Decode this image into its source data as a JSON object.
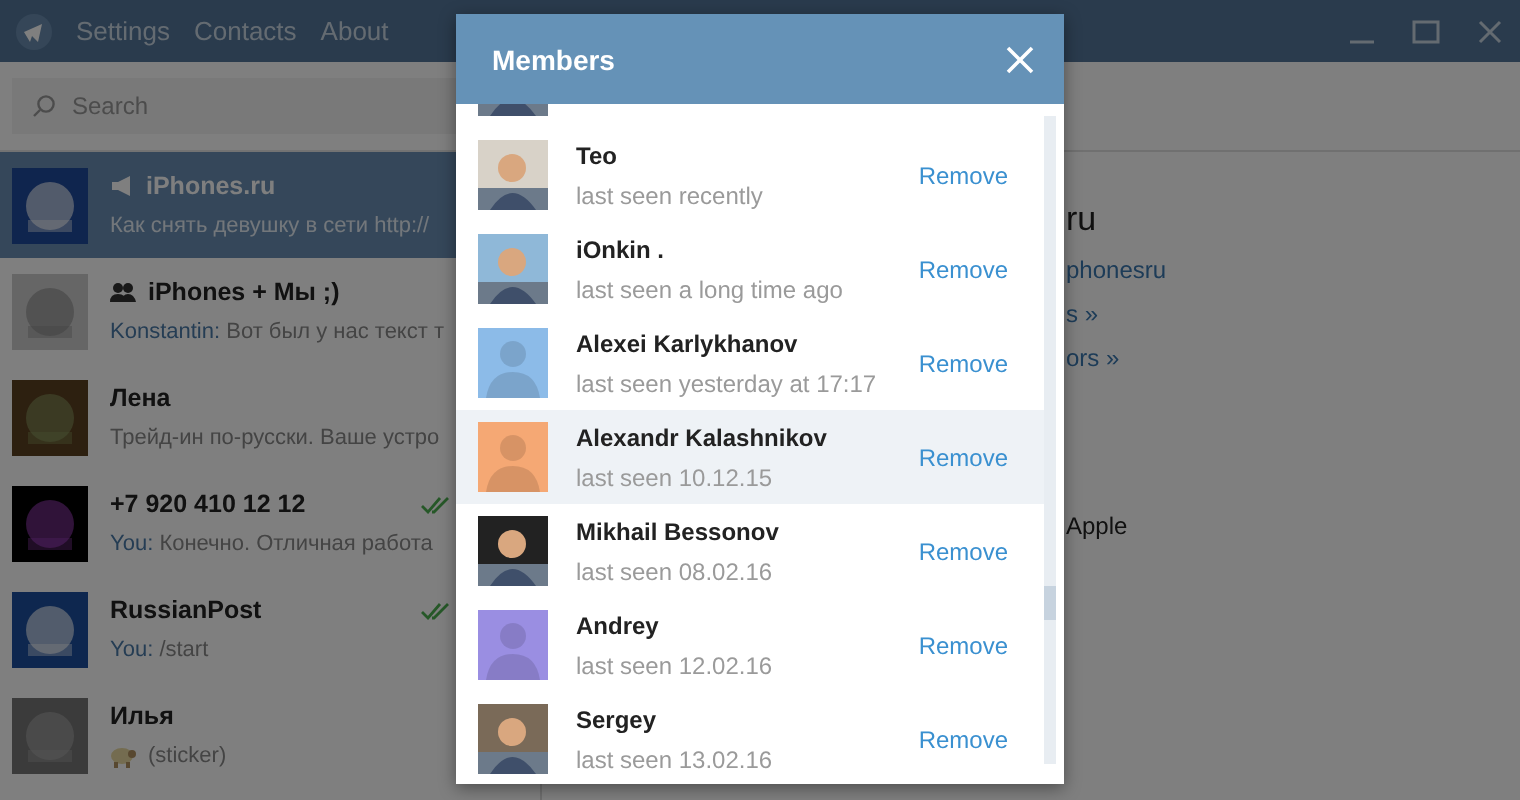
{
  "menu": [
    "Settings",
    "Contacts",
    "About"
  ],
  "search": {
    "placeholder": "Search"
  },
  "chats": [
    {
      "kind": "channel",
      "name": "iPhones.ru",
      "preview": "Как снять девушку в сети http://",
      "read": false,
      "selected": true
    },
    {
      "kind": "group",
      "name": "iPhones + Мы ;)",
      "preview_sender": "Konstantin:",
      "preview": "Вот был у нас текст т",
      "read": false,
      "selected": false
    },
    {
      "kind": "user",
      "name": "Лена",
      "preview": "Трейд-ин по-русски. Ваше устро",
      "read": false,
      "selected": false
    },
    {
      "kind": "user",
      "name": "+7 920 410 12 12",
      "preview_sender": "You:",
      "preview": "Конечно. Отличная работа",
      "read": true,
      "selected": false
    },
    {
      "kind": "user",
      "name": "RussianPost",
      "preview_sender": "You:",
      "preview": "/start",
      "read": true,
      "selected": false
    },
    {
      "kind": "user",
      "name": "Илья",
      "preview": "(sticker)",
      "sticker": true,
      "read": false,
      "selected": false
    }
  ],
  "profile": {
    "title": "ru",
    "link": "phonesru",
    "links": [
      "s »",
      "ors »"
    ],
    "about": "Apple"
  },
  "dialog": {
    "title": "Members",
    "members": [
      {
        "name": "Teo",
        "status": "last seen recently",
        "action": "Remove",
        "hovered": false
      },
      {
        "name": "iOnkin .",
        "status": "last seen a long time ago",
        "action": "Remove",
        "hovered": false
      },
      {
        "kind": "silhouette",
        "color": "#8cbbe8",
        "name": "Alexei Karlykhanov",
        "status": "last seen yesterday at 17:17",
        "action": "Remove",
        "hovered": false
      },
      {
        "kind": "silhouette",
        "color": "#f5a874",
        "name": "Alexandr Kalashnikov",
        "status": "last seen 10.12.15",
        "action": "Remove",
        "hovered": true
      },
      {
        "name": "Mikhail Bessonov",
        "status": "last seen 08.02.16",
        "action": "Remove",
        "hovered": false
      },
      {
        "kind": "silhouette",
        "color": "#9a8ee2",
        "name": "Andrey",
        "status": "last seen 12.02.16",
        "action": "Remove",
        "hovered": false
      },
      {
        "name": "Sergey",
        "status": "last seen 13.02.16",
        "action": "Remove",
        "hovered": false
      }
    ]
  }
}
